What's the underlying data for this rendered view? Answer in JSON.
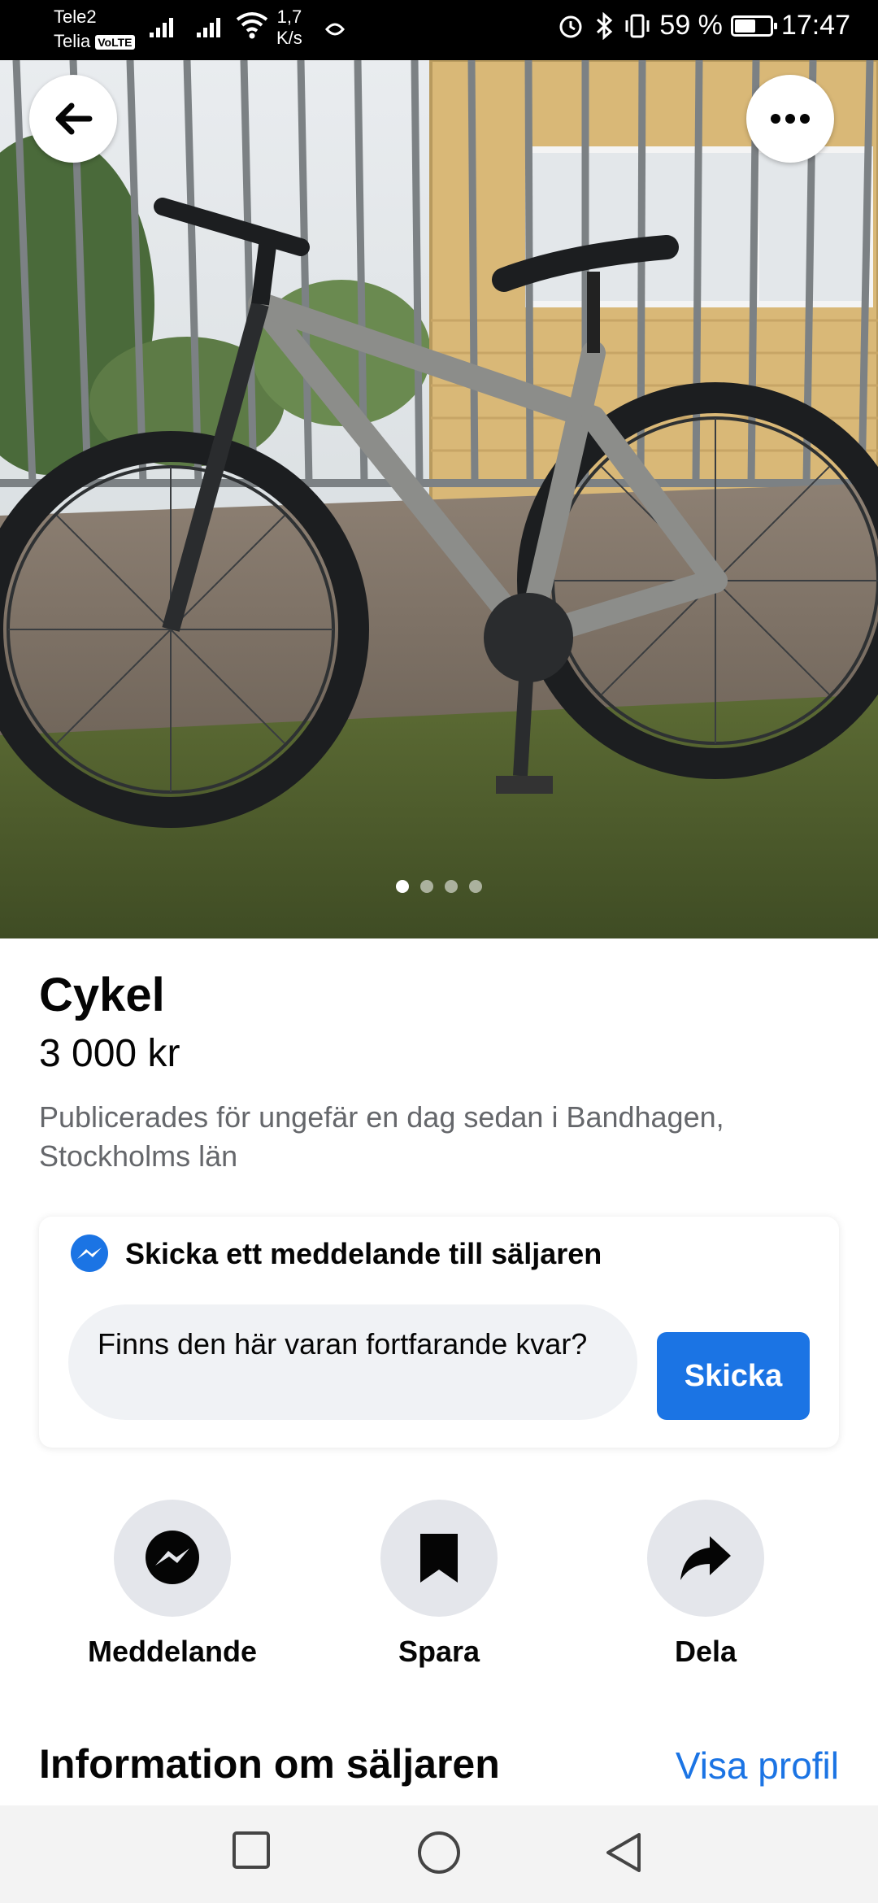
{
  "status_bar": {
    "carrier_1": "Tele2",
    "carrier_2": "Telia",
    "volte": "VoLTE",
    "speed_value": "1,7",
    "speed_unit": "K/s",
    "battery_percent": "59 %",
    "battery_level": 0.59,
    "time": "17:47"
  },
  "hero": {
    "back_icon": "arrow-left-icon",
    "more_icon": "more-horizontal-icon",
    "image_count": 4,
    "active_image": 1
  },
  "listing": {
    "title": "Cykel",
    "price": "3 000 kr",
    "posted": "Publicerades för ungefär en dag sedan i Bandhagen, Stockholms län"
  },
  "message_card": {
    "heading": "Skicka ett meddelande till säljaren",
    "icon": "messenger-icon",
    "input_value": "Finns den här varan fortfarande kvar?",
    "send_label": "Skicka"
  },
  "actions": [
    {
      "label": "Meddelande",
      "icon": "messenger-icon"
    },
    {
      "label": "Spara",
      "icon": "bookmark-icon"
    },
    {
      "label": "Dela",
      "icon": "share-icon"
    }
  ],
  "seller": {
    "heading": "Information om säljaren",
    "profile_link": "Visa profil"
  },
  "colors": {
    "accent": "#1b74e4",
    "secondary_text": "#65676b",
    "input_bg": "#f0f2f5",
    "icon_bg": "#e4e6eb"
  }
}
